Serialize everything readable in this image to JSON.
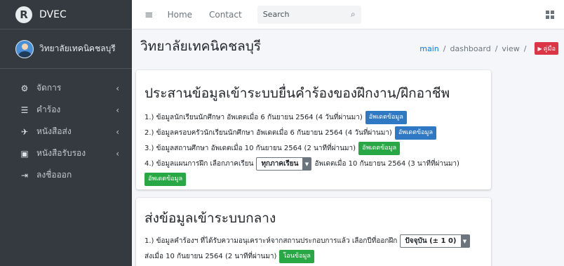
{
  "brand": {
    "logo": "R",
    "name": "DVEC"
  },
  "user": {
    "name": "วิทยาลัยเทคนิคชลบุรี"
  },
  "sidebar": {
    "items": [
      {
        "icon": "⚙",
        "label": "จัดการ",
        "chevron": "‹"
      },
      {
        "icon": "☰",
        "label": "คำร้อง",
        "chevron": "‹"
      },
      {
        "icon": "✈",
        "label": "หนังสือส่ง",
        "chevron": "‹"
      },
      {
        "icon": "▣",
        "label": "หนังสือรับรอง",
        "chevron": "‹"
      },
      {
        "icon": "⇥",
        "label": "ลงชื่อออก"
      }
    ]
  },
  "topbar": {
    "menu_icon": "≡",
    "links": [
      "Home",
      "Contact"
    ],
    "search_placeholder": "Search",
    "search_icon": "⌕"
  },
  "header": {
    "title": "วิทยาลัยเทคนิคชลบุรี",
    "breadcrumb": [
      "main",
      "dashboard",
      "view"
    ],
    "separator": "/",
    "manual_label": "คู่มือ",
    "manual_icon": "▶"
  },
  "card1": {
    "title": "ประสานข้อมูลเข้าระบบยื่นคำร้องของฝึกงาน/ฝึกอาชีพ",
    "rows": [
      {
        "text": "1.) ข้อมูลนักเรียนนักศึกษา อัพเดตเมื่อ 6 กันยายน 2564 (4 วันที่ผ่านมา)",
        "button": "อัพเดตข้อมูล"
      },
      {
        "text": "2.) ข้อมูลครอบครัวนักเรียนนักศึกษา อัพเดตเมื่อ 6 กันยายน 2564 (4 วันที่ผ่านมา)",
        "button": "อัพเดตข้อมูล"
      },
      {
        "text": "3.) ข้อมูลสถานศึกษา อัพเดตเมื่อ 10 กันยายน 2564 (2 นาทีที่ผ่านมา)",
        "button": "อัพเดตข้อมูล"
      },
      {
        "text_before": "4.) ข้อมูลแผนการฝึก เลือกภาคเรียน",
        "select": "ทุกภาคเรียน",
        "text_after": "อัพเดตเมื่อ 10 กันยายน 2564 (3 นาทีที่ผ่านมา)",
        "button": "อัพเดตข้อมูล"
      }
    ]
  },
  "card2": {
    "title": "ส่งข้อมูลเข้าระบบกลาง",
    "row_text_before": "1.) ข้อมูลคำร้องฯ ที่ได้รับความอนุเคราะห์จากสถานประกอบการแล้ว เลือกปีที่ออกฝึก",
    "select": "ปัจจุบัน (± 1 0)",
    "row_text_after": "ส่งเมื่อ 10 กันยายน 2564 (2 นาทีที่ผ่านมา)",
    "button": "โอนข้อมูล"
  },
  "colors": {
    "sidebar": "#343a40",
    "primary": "#2f78c4",
    "success": "#28a745",
    "danger": "#dc3545",
    "link": "#007bff"
  }
}
